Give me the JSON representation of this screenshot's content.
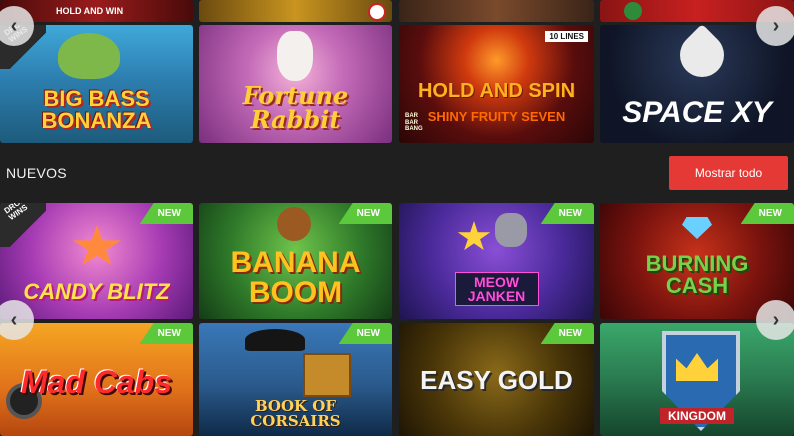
{
  "top_strip": [
    {
      "label": "HOLD AND WIN"
    },
    {
      "label": ""
    },
    {
      "label": ""
    },
    {
      "label": ""
    }
  ],
  "top_games": [
    {
      "title": "BIG BASS BONANZA",
      "ribbon": "DROPS & WINS"
    },
    {
      "title": "Fortune Rabbit"
    },
    {
      "title": "HOLD AND SPIN",
      "subtitle": "SHINY FRUITY SEVEN",
      "tag": "10 LINES",
      "side": "BAR BAR BANG"
    },
    {
      "title": "SPACE XY"
    }
  ],
  "section": {
    "title": "NUEVOS",
    "show_all": "Mostrar todo"
  },
  "new_games_row1": [
    {
      "title": "CANDY BLITZ",
      "badge": "NEW",
      "ribbon": "DROPS & WINS"
    },
    {
      "title": "BANANA BOOM",
      "badge": "NEW"
    },
    {
      "title": "MEOW JANKEN",
      "badge": "NEW"
    },
    {
      "title": "BURNING CASH",
      "badge": "NEW"
    }
  ],
  "new_games_row2": [
    {
      "title": "Mad Cabs",
      "badge": "NEW"
    },
    {
      "title": "BOOK OF CORSAIRS",
      "badge": "NEW"
    },
    {
      "title": "EASY GOLD",
      "badge": "NEW"
    },
    {
      "title": "KINGDOM",
      "badge": ""
    }
  ],
  "arrows": {
    "left": "‹",
    "right": "›"
  },
  "colors": {
    "background": "#1f1f1f",
    "accent_red": "#e53935",
    "new_badge": "#5cc83b"
  }
}
